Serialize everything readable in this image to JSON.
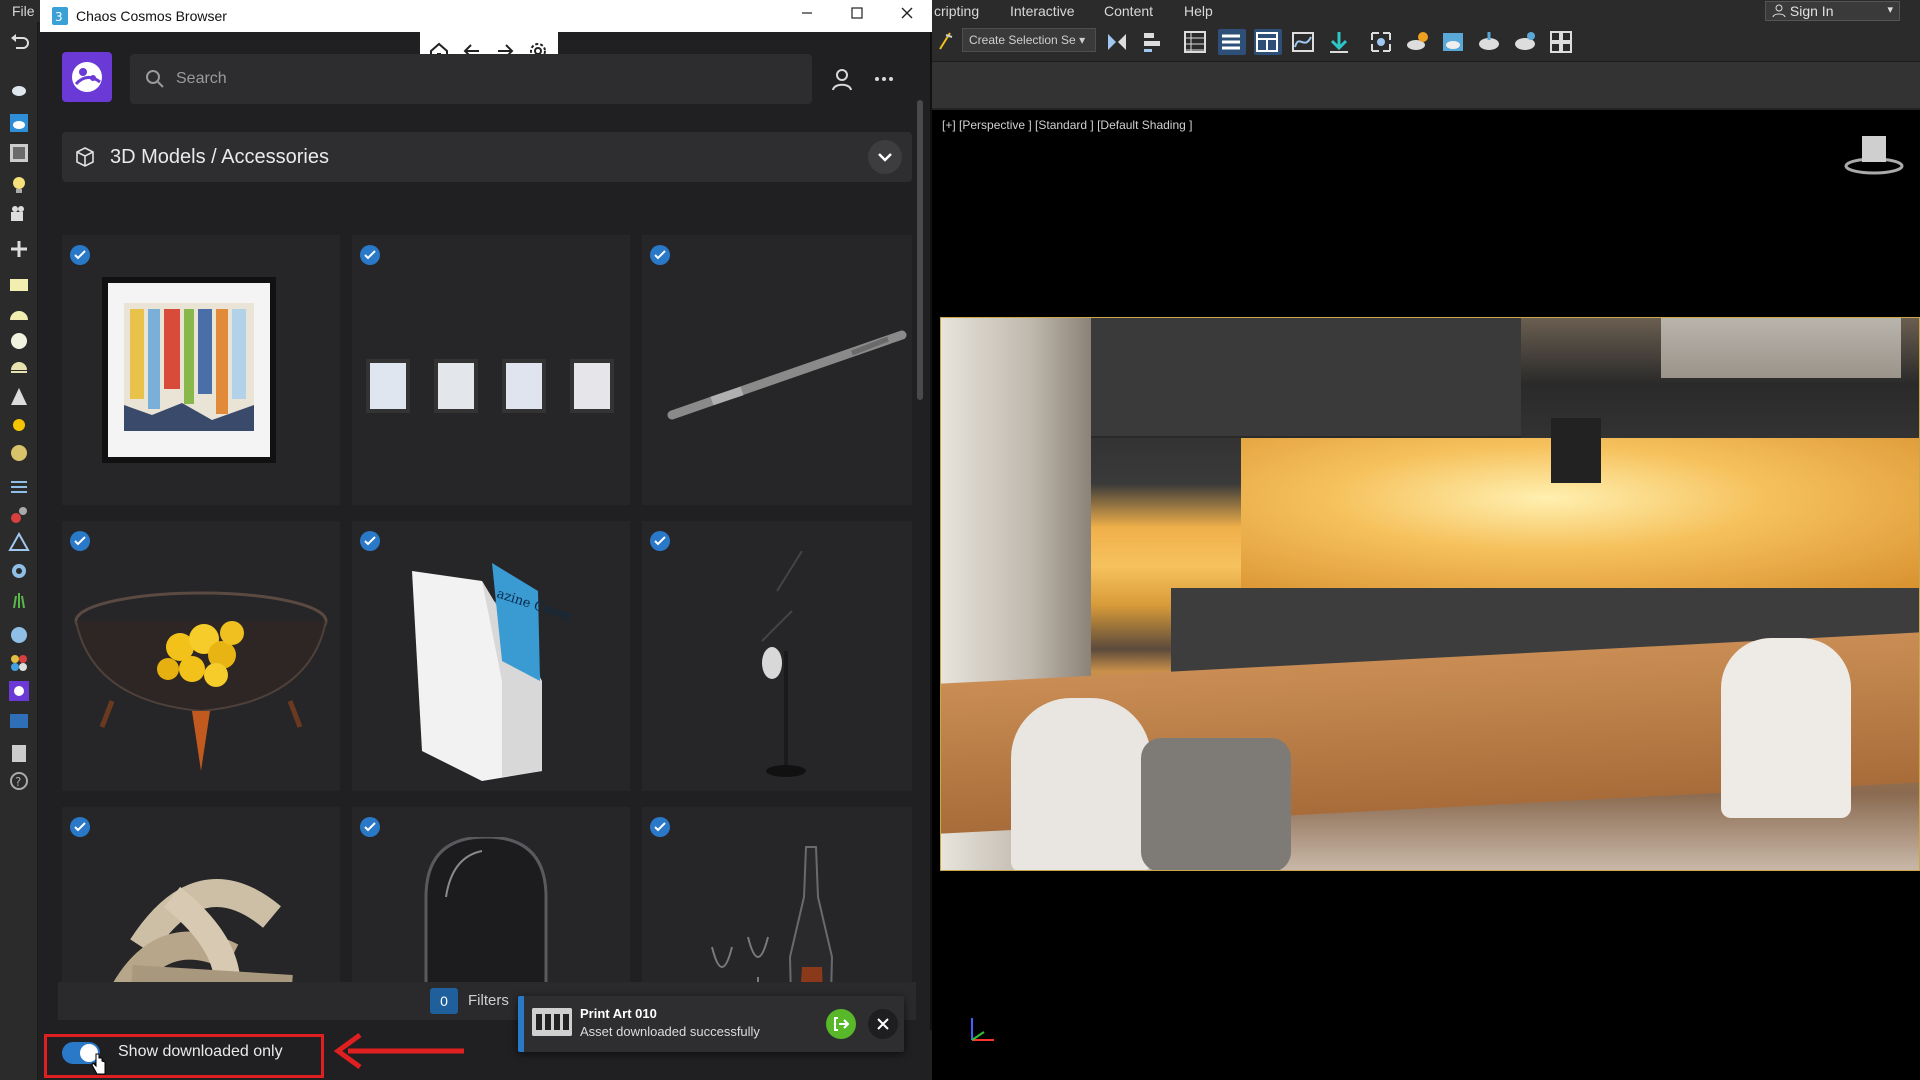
{
  "host": {
    "menu": {
      "file": "File",
      "scripting": "cripting",
      "interactive": "Interactive",
      "content": "Content",
      "help": "Help"
    },
    "sign_in": "Sign In",
    "selection_set": "Create Selection Se",
    "viewport_label": "[+] [Perspective ] [Standard ] [Default Shading ]"
  },
  "cosmos": {
    "window_title": "Chaos Cosmos Browser",
    "search": {
      "placeholder": "Search",
      "value": ""
    },
    "breadcrumb": "3D Models / Accessories",
    "filters": {
      "count": "0",
      "label": "Filters"
    },
    "show_downloaded_label": "Show downloaded only",
    "show_downloaded_on": true,
    "assets": [
      {
        "name": "print-art",
        "downloaded": true
      },
      {
        "name": "paper-frames",
        "downloaded": true
      },
      {
        "name": "pen",
        "downloaded": true
      },
      {
        "name": "fruit-bowl",
        "downloaded": true
      },
      {
        "name": "magazine-holder",
        "downloaded": true
      },
      {
        "name": "floor-lamp",
        "downloaded": true
      },
      {
        "name": "wooden-sphere",
        "downloaded": true
      },
      {
        "name": "glass-dome",
        "downloaded": true
      },
      {
        "name": "wine-set",
        "downloaded": true
      }
    ],
    "toast": {
      "title": "Print Art 010",
      "message": "Asset downloaded successfully"
    }
  },
  "colors": {
    "accent": "#2a78c8",
    "brand": "#6b3ad6",
    "success": "#58b82a",
    "annotation": "#e02020"
  }
}
